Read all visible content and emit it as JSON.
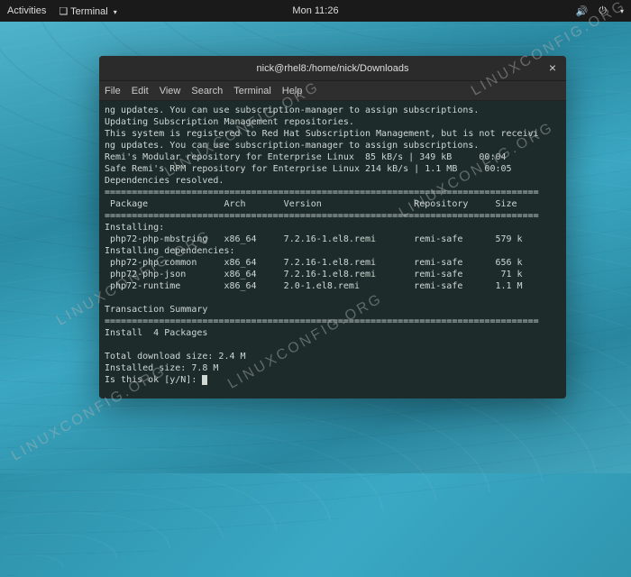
{
  "topbar": {
    "activities": "Activities",
    "app_indicator": "Terminal",
    "clock": "Mon 11:26"
  },
  "window": {
    "title": "nick@rhel8:/home/nick/Downloads",
    "menu": {
      "file": "File",
      "edit": "Edit",
      "view": "View",
      "search": "Search",
      "terminal": "Terminal",
      "help": "Help"
    }
  },
  "watermark": "LINUXCONFIG.ORG",
  "term": {
    "lines": [
      "ng updates. You can use subscription-manager to assign subscriptions.",
      "Updating Subscription Management repositories.",
      "This system is registered to Red Hat Subscription Management, but is not receivi",
      "ng updates. You can use subscription-manager to assign subscriptions.",
      "Remi's Modular repository for Enterprise Linux  85 kB/s | 349 kB     00:04",
      "Safe Remi's RPM repository for Enterprise Linux 214 kB/s | 1.1 MB     00:05",
      "Dependencies resolved.",
      "================================================================================",
      " Package              Arch       Version                 Repository     Size",
      "================================================================================",
      "Installing:",
      " php72-php-mbstring   x86_64     7.2.16-1.el8.remi       remi-safe      579 k",
      "Installing dependencies:",
      " php72-php-common     x86_64     7.2.16-1.el8.remi       remi-safe      656 k",
      " php72-php-json       x86_64     7.2.16-1.el8.remi       remi-safe       71 k",
      " php72-runtime        x86_64     2.0-1.el8.remi          remi-safe      1.1 M",
      "",
      "Transaction Summary",
      "================================================================================",
      "Install  4 Packages",
      "",
      "Total download size: 2.4 M",
      "Installed size: 7.8 M",
      "Is this ok [y/N]: "
    ]
  }
}
